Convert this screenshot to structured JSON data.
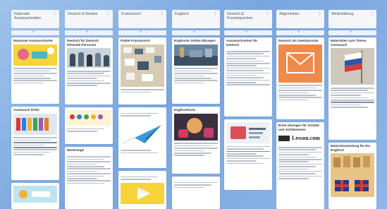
{
  "columns": [
    {
      "title": "Nationale Austauschseiten",
      "cards": [
        {
          "title": "Nationale Austauschseite"
        },
        {
          "title": "Austausch Dritte"
        },
        {
          "title": ""
        }
      ]
    },
    {
      "title": "Deutsch & Medien",
      "cards": [
        {
          "title": "Deutsch für Deutsch lehrende Personen"
        },
        {
          "title": ""
        },
        {
          "title": "Werkzeuge"
        }
      ]
    },
    {
      "title": "Französisch",
      "cards": [
        {
          "title": "Padlet Französisch"
        },
        {
          "title": ""
        },
        {
          "title": ""
        }
      ]
    },
    {
      "title": "Englisch",
      "cards": [
        {
          "title": "Englische Online-Übungen"
        },
        {
          "title": "Englischtools"
        },
        {
          "title": ""
        }
      ]
    },
    {
      "title": "Deutsch & Fremdsprachen",
      "cards": [
        {
          "title": "Austauschseiten für Deutsch"
        },
        {
          "title": ""
        }
      ]
    },
    {
      "title": "Allgemeines",
      "cards": [
        {
          "title": "Deutsch als Zweitsprache"
        },
        {
          "title": "Erste Übungen für Schüler und Schülerinnen"
        }
      ]
    },
    {
      "title": "Weiterbildung",
      "cards": [
        {
          "title": "Materialien zum Thema Austausch"
        },
        {
          "title": "Materialsammlung für EU-Englisch"
        }
      ]
    }
  ],
  "brand_text": "Lesson.com",
  "icons": [
    "mail-envelope-icon",
    "paper-plane-icon",
    "play-icon",
    "flag-icon"
  ],
  "colors": {
    "background": "#8fb6e6",
    "mail_orange": "#f08a4b",
    "yellow": "#f6d33b",
    "card": "#ffffff"
  }
}
